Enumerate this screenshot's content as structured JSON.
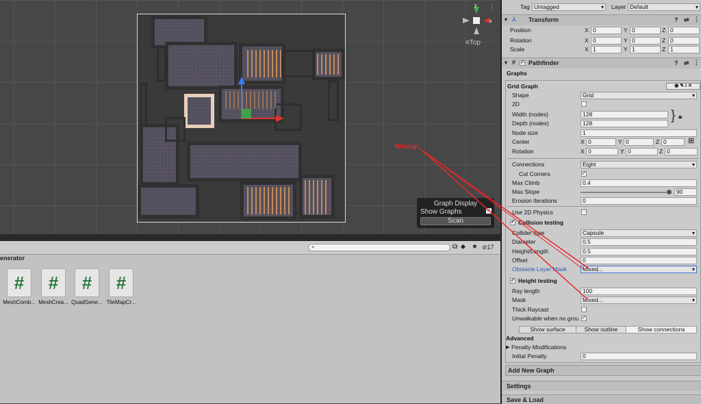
{
  "scene": {
    "view_label": "Top",
    "axis_labels": {
      "y": "y",
      "x": "x"
    },
    "graph_display": {
      "title": "Graph Display",
      "show_graphs_label": "Show Graphs",
      "show_graphs_checked": true,
      "scan_label": "Scan"
    },
    "annotation": {
      "text": "Wrong!",
      "color": "#e8262a"
    }
  },
  "project": {
    "search_placeholder": "",
    "hidden_count": "17",
    "folder_label": "enerator",
    "assets": [
      {
        "label": "MeshComb...",
        "icon": "csharp-script-icon"
      },
      {
        "label": "MeshCrea...",
        "icon": "csharp-script-icon"
      },
      {
        "label": "QuadGene...",
        "icon": "csharp-script-icon"
      },
      {
        "label": "TileMapCr...",
        "icon": "csharp-script-icon"
      }
    ]
  },
  "inspector": {
    "tag_label": "Tag",
    "tag_value": "Untagged",
    "layer_label": "Layer",
    "layer_value": "Default",
    "transform": {
      "title": "Transform",
      "rows": [
        {
          "label": "Position",
          "x": "0",
          "y": "0",
          "z": "0"
        },
        {
          "label": "Rotation",
          "x": "0",
          "y": "0",
          "z": "0"
        },
        {
          "label": "Scale",
          "x": "1",
          "y": "1",
          "z": "1"
        }
      ],
      "axis": {
        "x": "X",
        "y": "Y",
        "z": "Z"
      }
    },
    "pathfinder": {
      "title": "Pathfinder",
      "graphs_label": "Graphs",
      "grid_graph_label": "Grid Graph",
      "shape_label": "Shape",
      "shape_value": "Grid",
      "twod_label": "2D",
      "width_label": "Width (nodes)",
      "width_value": "128",
      "depth_label": "Depth (nodes)",
      "depth_value": "128",
      "node_size_label": "Node size",
      "node_size_value": "1",
      "center_label": "Center",
      "center": {
        "x": "0",
        "y": "0",
        "z": "0"
      },
      "rotation_label": "Rotation",
      "rotation": {
        "x": "0",
        "y": "0",
        "z": "0"
      },
      "connections_label": "Connections",
      "connections_value": "Eight",
      "cut_corners_label": "Cut Corners",
      "max_climb_label": "Max Climb",
      "max_climb_value": "0.4",
      "max_slope_label": "Max Slope",
      "max_slope_value": "90",
      "erosion_label": "Erosion iterations",
      "erosion_value": "0",
      "use2d_label": "Use 2D Physics",
      "collision_label": "Collision testing",
      "collider_type_label": "Collider type",
      "collider_type_value": "Capsule",
      "diameter_label": "Diameter",
      "diameter_value": "0.5",
      "height_length_label": "Height/Length",
      "height_length_value": "0.5",
      "offset_label": "Offset",
      "offset_value": "0",
      "obstacle_label": "Obstacle Layer Mask",
      "obstacle_value": "Mixed...",
      "height_testing_label": "Height testing",
      "ray_length_label": "Ray length",
      "ray_length_value": "100",
      "mask_label": "Mask",
      "mask_value": "Mixed...",
      "thick_raycast_label": "Thick Raycast",
      "unwalkable_label": "Unwalkable when no groui",
      "show_surface": "Show surface",
      "show_outline": "Show outline",
      "show_connections": "Show connections",
      "advanced_label": "Advanced",
      "penalty_mod_label": "Penalty Modifications",
      "initial_penalty_label": "Initial Penalty",
      "initial_penalty_value": "0",
      "add_graph_label": "Add New Graph",
      "settings_label": "Settings",
      "save_load_label": "Save & Load"
    }
  }
}
